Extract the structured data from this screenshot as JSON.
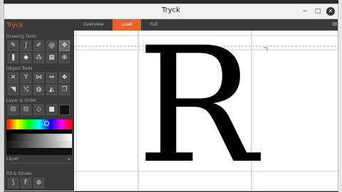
{
  "window": {
    "title": "Tryck"
  },
  "app": {
    "name": "Tryck"
  },
  "sections": {
    "drawing_tools": "Drawing Tools",
    "object_tools": "Object Tools",
    "layer_order": "Layer & Order",
    "layer": "Layer",
    "fill_stroke": "Fill & Stroke"
  },
  "tabs": [
    {
      "label": "Overview"
    },
    {
      "label": "Load"
    },
    {
      "label": "Full"
    }
  ],
  "canvas": {
    "glyph": "R"
  },
  "icons": {
    "tool_pen": "✎",
    "tool_brush": "∫",
    "tool_pencil": "✐",
    "tool_spiral": "@",
    "tool_node": "⌂",
    "tool_cross": "✥",
    "tool_paint": "❚",
    "tool_fill": "◆",
    "tool_spray": "⁂",
    "tool_measure": "▦",
    "tool_zoom": "⊕",
    "obj_a": "✕",
    "obj_b": "Y",
    "obj_c": "⋈",
    "obj_d": "⇔",
    "obj_e": "❖",
    "obj_f": "◥",
    "obj_g": "⤭",
    "obj_h": "◍",
    "obj_i": "◭",
    "obj_j": "❐",
    "order_a": "⊟",
    "order_b": "⊟",
    "order_c": "◇",
    "order_d": "■",
    "fs_a": "⟆",
    "fs_b": "F",
    "fs_c": "⊛",
    "close": "✕",
    "maximize": "□",
    "minimize": "−",
    "menu": "≡",
    "chevron": "▸"
  },
  "colors": {
    "accent": "#e8632a",
    "panel": "#3a3a3a"
  }
}
